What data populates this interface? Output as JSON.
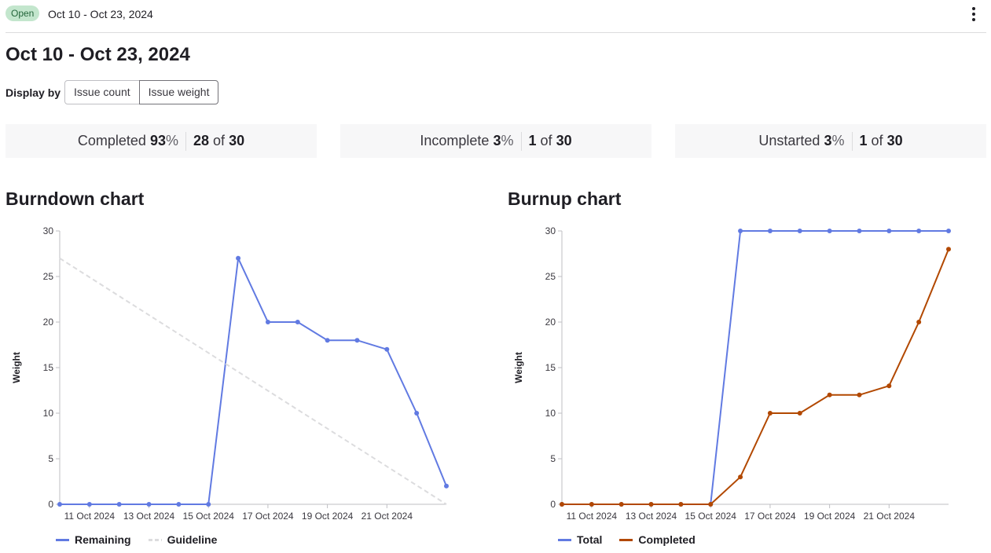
{
  "header": {
    "status_badge": "Open",
    "dates": "Oct 10 - Oct 23, 2024",
    "menu_icon": "kebab-vertical-icon"
  },
  "page": {
    "title": "Oct 10 - Oct 23, 2024"
  },
  "display_by": {
    "label": "Display by",
    "options": [
      "Issue count",
      "Issue weight"
    ],
    "selected": "Issue weight"
  },
  "stats": [
    {
      "label": "Completed",
      "percent": "93",
      "percent_sign": "%",
      "count": "28",
      "of": "of",
      "total": "30"
    },
    {
      "label": "Incomplete",
      "percent": "3",
      "percent_sign": "%",
      "count": "1",
      "of": "of",
      "total": "30"
    },
    {
      "label": "Unstarted",
      "percent": "3",
      "percent_sign": "%",
      "count": "1",
      "of": "of",
      "total": "30"
    }
  ],
  "colors": {
    "blue": "#617ae2",
    "orange": "#b24800",
    "guideline": "#dcdcde",
    "badge_bg": "#c3e6cd",
    "badge_text": "#24663b"
  },
  "chart_data": [
    {
      "type": "line",
      "title": "Burndown chart",
      "ylabel": "Weight",
      "xlabel": "",
      "ylim": [
        0,
        30
      ],
      "yticks": [
        0,
        5,
        10,
        15,
        20,
        25,
        30
      ],
      "x": [
        "10 Oct 2024",
        "11 Oct 2024",
        "12 Oct 2024",
        "13 Oct 2024",
        "14 Oct 2024",
        "15 Oct 2024",
        "16 Oct 2024",
        "17 Oct 2024",
        "18 Oct 2024",
        "19 Oct 2024",
        "20 Oct 2024",
        "21 Oct 2024",
        "22 Oct 2024",
        "23 Oct 2024"
      ],
      "xtick_labels": [
        "11 Oct 2024",
        "13 Oct 2024",
        "15 Oct 2024",
        "17 Oct 2024",
        "19 Oct 2024",
        "21 Oct 2024"
      ],
      "series": [
        {
          "name": "Remaining",
          "color": "#617ae2",
          "style": "solid",
          "markers": true,
          "values": [
            0,
            0,
            0,
            0,
            0,
            0,
            27,
            20,
            20,
            18,
            18,
            17,
            10,
            2
          ]
        },
        {
          "name": "Guideline",
          "color": "#dcdcde",
          "style": "dashed",
          "markers": false,
          "values": [
            27,
            null,
            null,
            null,
            null,
            null,
            null,
            null,
            null,
            null,
            null,
            null,
            null,
            0
          ]
        }
      ],
      "legend": "bottom-left",
      "grid": false
    },
    {
      "type": "line",
      "title": "Burnup chart",
      "ylabel": "Weight",
      "xlabel": "",
      "ylim": [
        0,
        30
      ],
      "yticks": [
        0,
        5,
        10,
        15,
        20,
        25,
        30
      ],
      "x": [
        "10 Oct 2024",
        "11 Oct 2024",
        "12 Oct 2024",
        "13 Oct 2024",
        "14 Oct 2024",
        "15 Oct 2024",
        "16 Oct 2024",
        "17 Oct 2024",
        "18 Oct 2024",
        "19 Oct 2024",
        "20 Oct 2024",
        "21 Oct 2024",
        "22 Oct 2024",
        "23 Oct 2024"
      ],
      "xtick_labels": [
        "11 Oct 2024",
        "13 Oct 2024",
        "15 Oct 2024",
        "17 Oct 2024",
        "19 Oct 2024",
        "21 Oct 2024"
      ],
      "series": [
        {
          "name": "Total",
          "color": "#617ae2",
          "style": "solid",
          "markers": true,
          "values": [
            0,
            0,
            0,
            0,
            0,
            0,
            30,
            30,
            30,
            30,
            30,
            30,
            30,
            30
          ]
        },
        {
          "name": "Completed",
          "color": "#b24800",
          "style": "solid",
          "markers": true,
          "values": [
            0,
            0,
            0,
            0,
            0,
            0,
            3,
            10,
            10,
            12,
            12,
            13,
            20,
            28
          ]
        }
      ],
      "legend": "bottom-left",
      "grid": false
    }
  ]
}
